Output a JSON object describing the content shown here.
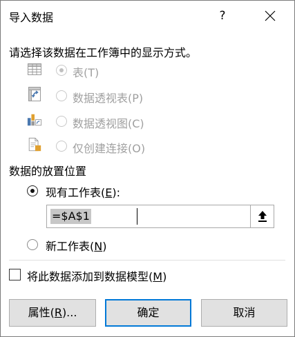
{
  "window": {
    "title": "导入数据",
    "help_label": "?"
  },
  "prompt": "请选择该数据在工作簿中的显示方式。",
  "view_options": [
    {
      "label": "表(T)",
      "icon": "table-icon",
      "state": "selected-disabled"
    },
    {
      "label": "数据透视表(P)",
      "icon": "pivot-table-icon",
      "state": "disabled"
    },
    {
      "label": "数据透视图(C)",
      "icon": "pivot-chart-icon",
      "state": "disabled"
    },
    {
      "label": "仅创建连接(O)",
      "icon": "connection-only-icon",
      "state": "disabled"
    }
  ],
  "placement": {
    "title": "数据的放置位置",
    "existing_sheet": {
      "prefix": "现有工作表(",
      "accel": "E",
      "suffix": "):"
    },
    "range_value": "=$A$1",
    "new_sheet": {
      "prefix": "新工作表(",
      "accel": "N",
      "suffix": ")"
    }
  },
  "data_model": {
    "prefix": "将此数据添加到数据模型(",
    "accel": "M",
    "suffix": ")",
    "checked": false
  },
  "buttons": {
    "properties": {
      "prefix": "属性(",
      "accel": "R",
      "suffix": ")..."
    },
    "ok": "确定",
    "cancel": "取消"
  },
  "colors": {
    "accent": "#0078d7",
    "disabled_text": "#a0a0a0",
    "button_bg": "#e1e1e1"
  }
}
